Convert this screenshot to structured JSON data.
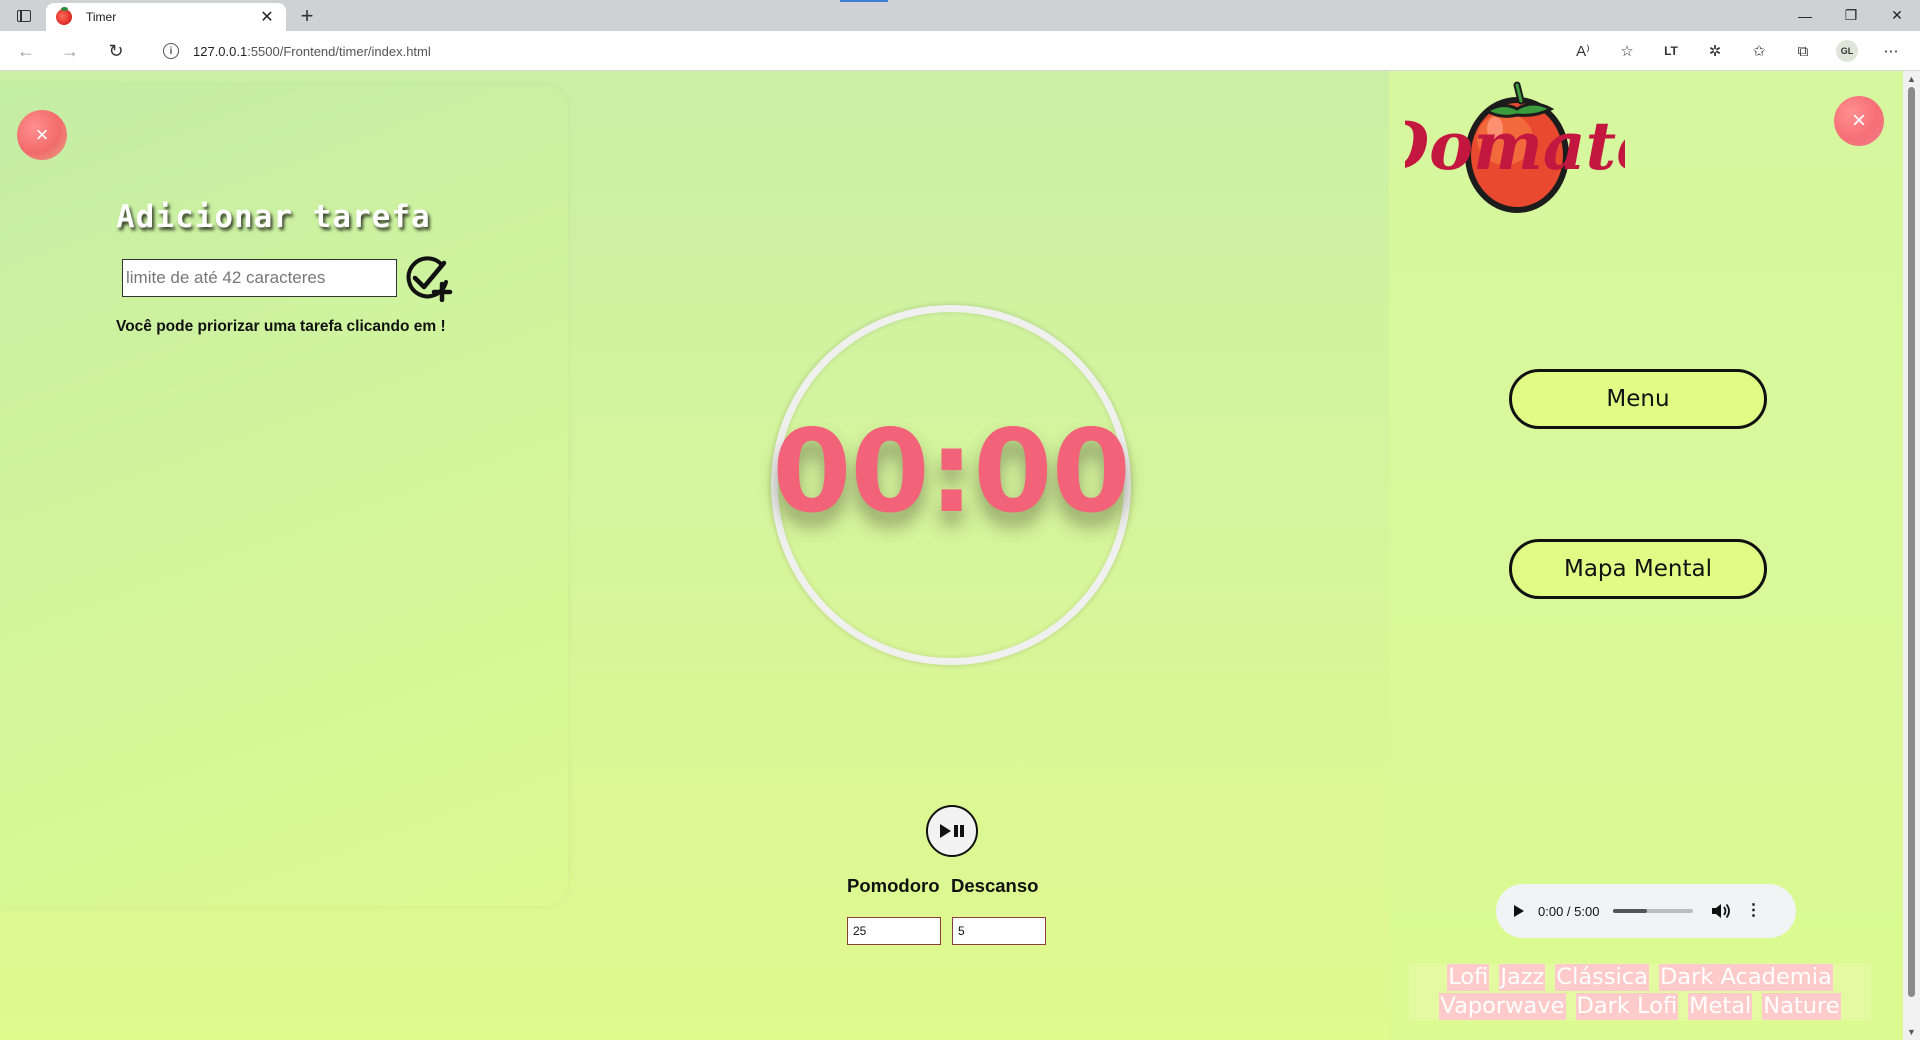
{
  "browser": {
    "tab_title": "Timer",
    "new_tab": "+",
    "url_host": "127.0.0.1",
    "url_path": ":5500/Frontend/timer/index.html",
    "profile_initials": "GL"
  },
  "tasks": {
    "close_label": "×",
    "title": "Adicionar tarefa",
    "input_placeholder": "limite de até 42 caracteres",
    "hint": "Você pode priorizar uma tarefa clicando em !"
  },
  "timer": {
    "display": "00:00",
    "pomodoro_label": "Pomodoro",
    "descanso_label": "Descanso",
    "pomodoro_value": "25",
    "descanso_value": "5"
  },
  "sidebar": {
    "logo_text": "Domate",
    "close_label": "×",
    "menu_label": "Menu",
    "mapa_label": "Mapa Mental"
  },
  "audio": {
    "time": "0:00 / 5:00",
    "progress_fraction": 0.0,
    "volume_fraction": 0.4
  },
  "genres": [
    "Lofi",
    "Jazz",
    "Clássica",
    "Dark Academia",
    "Vaporwave",
    "Dark Lofi",
    "Metal",
    "Nature"
  ],
  "colors": {
    "timer": "#f2637a",
    "close_button": "#f26b6b",
    "pill_button": "#e1fc85",
    "genre_bg": "#ffcaca",
    "logo": "#c4173f"
  }
}
